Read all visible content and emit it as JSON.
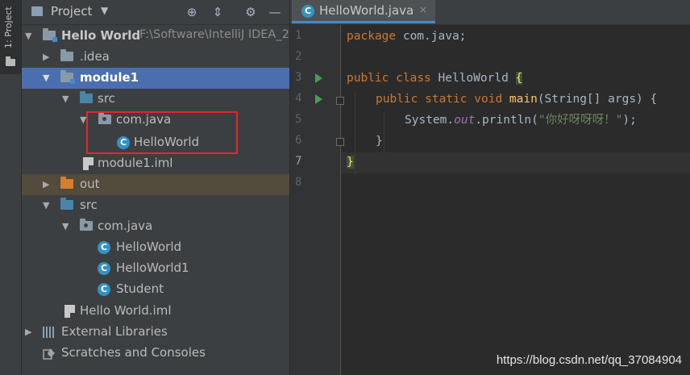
{
  "toolstrip": {
    "project_tab_label": "1: Project"
  },
  "project_panel": {
    "title": "Project",
    "tree": [
      {
        "label": "Hello World",
        "path": "F:\\Software\\IntelliJ IDEA_2"
      },
      {
        "label": ".idea"
      },
      {
        "label": "module1"
      },
      {
        "label": "src"
      },
      {
        "label": "com.java"
      },
      {
        "label": "HelloWorld"
      },
      {
        "label": "module1.iml"
      },
      {
        "label": "out"
      },
      {
        "label": "src"
      },
      {
        "label": "com.java"
      },
      {
        "label": "HelloWorld"
      },
      {
        "label": "HelloWorld1"
      },
      {
        "label": "Student"
      },
      {
        "label": "Hello World.iml"
      },
      {
        "label": "External Libraries"
      },
      {
        "label": "Scratches and Consoles"
      }
    ],
    "class_icon_letter": "C"
  },
  "editor": {
    "tab_label": "HelloWorld.java",
    "tab_close": "×",
    "line_numbers": [
      "1",
      "2",
      "3",
      "4",
      "5",
      "6",
      "7",
      "8"
    ],
    "code": {
      "l1_kw": "package",
      "l1_rest": " com.java;",
      "l3_kw1": "public",
      "l3_kw2": "class",
      "l3_name": " HelloWorld ",
      "l3_brace": "{",
      "l4_kw1": "public",
      "l4_kw2": "static",
      "l4_kw3": "void",
      "l4_fn": "main",
      "l4_rest": "(String[] args) {",
      "l5_pre": "System.",
      "l5_out": "out",
      "l5_mid": ".println(",
      "l5_str": "\"你好呀呀呀！\"",
      "l5_end": ");",
      "l6": "}",
      "l7": "}"
    }
  },
  "watermark": "https://blog.csdn.net/qq_37084904",
  "colors": {
    "selection": "#4b6eaf",
    "highlight_box": "#e8262c",
    "keyword": "#cc7832",
    "string": "#6a8759"
  }
}
